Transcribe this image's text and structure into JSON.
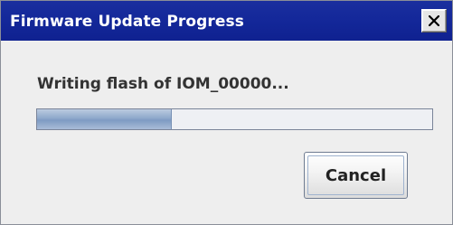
{
  "window": {
    "title": "Firmware Update Progress"
  },
  "dialog": {
    "message": "Writing flash of IOM_00000...",
    "progress_fraction": 0.34,
    "cancel_label": "Cancel"
  },
  "icons": {
    "close": "close-icon"
  },
  "colors": {
    "titlebar": "#14289a",
    "title_text": "#ffffff",
    "progress_fill": "#8ea8cb",
    "dialog_bg": "#eeeeee"
  }
}
